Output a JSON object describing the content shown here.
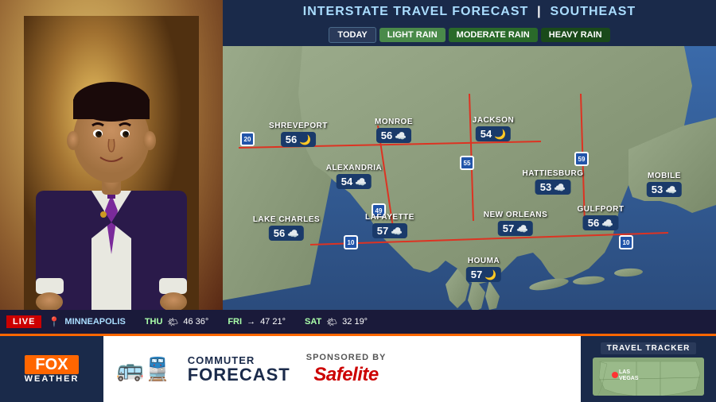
{
  "header": {
    "title": "INTERSTATE TRAVEL FORECAST",
    "region": "SOUTHEAST"
  },
  "legend": {
    "today": "TODAY",
    "light_rain": "LIGHT RAIN",
    "moderate_rain": "MODERATE RAIN",
    "heavy_rain": "HEAVY RAIN"
  },
  "cities": [
    {
      "name": "SHREVEPORT",
      "temp": "56",
      "icon": "🌙",
      "top": "110",
      "left": "95"
    },
    {
      "name": "MONROE",
      "temp": "56",
      "icon": "☁️",
      "top": "105",
      "left": "215"
    },
    {
      "name": "JACKSON",
      "temp": "54",
      "icon": "🌙",
      "top": "105",
      "left": "340"
    },
    {
      "name": "HATTIESBURG",
      "temp": "53",
      "icon": "☁️",
      "top": "170",
      "left": "415"
    },
    {
      "name": "MOBILE",
      "temp": "53",
      "icon": "☁️",
      "top": "175",
      "left": "550"
    },
    {
      "name": "ALEXANDRIA",
      "temp": "54",
      "icon": "☁️",
      "top": "165",
      "left": "165"
    },
    {
      "name": "LAKE CHARLES",
      "temp": "56",
      "icon": "☁️",
      "top": "230",
      "left": "80"
    },
    {
      "name": "LAFAYETTE",
      "temp": "57",
      "icon": "☁️",
      "top": "230",
      "left": "210"
    },
    {
      "name": "NEW ORLEANS",
      "temp": "57",
      "icon": "☁️",
      "top": "225",
      "left": "370"
    },
    {
      "name": "GULFPORT",
      "temp": "56",
      "icon": "☁️",
      "top": "220",
      "left": "475"
    },
    {
      "name": "HOUMA",
      "temp": "57",
      "icon": "🌙",
      "top": "285",
      "left": "330"
    }
  ],
  "interstates": [
    {
      "number": "20",
      "top": "120",
      "left": "20"
    },
    {
      "number": "55",
      "top": "140",
      "left": "305"
    },
    {
      "number": "59",
      "top": "140",
      "left": "440"
    },
    {
      "number": "49",
      "top": "200",
      "left": "185"
    },
    {
      "number": "10",
      "top": "240",
      "left": "155"
    },
    {
      "number": "10",
      "top": "240",
      "left": "500"
    }
  ],
  "bottom_bar": {
    "fox_text": "FOX",
    "weather_text": "WEATHER",
    "commuter_label": "COMMUTER",
    "forecast_label": "FORECAST",
    "sponsored_by": "SPONSORED BY",
    "safelite": "Safelite",
    "travel_tracker": "TRAVEL TRACKER",
    "las_vegas": "LAS VEGAS"
  },
  "ticker": {
    "live": "LIVE",
    "items": [
      {
        "icon": "📍",
        "city": "MINNEAPOLIS",
        "day1": "THU",
        "icon1": "🌤",
        "temp1": "46 36°",
        "day2": "FRI",
        "icon2": "→",
        "temp2": "47 21°",
        "day3": "SAT",
        "icon3": "🌤",
        "temp3": "32 19°"
      }
    ]
  }
}
